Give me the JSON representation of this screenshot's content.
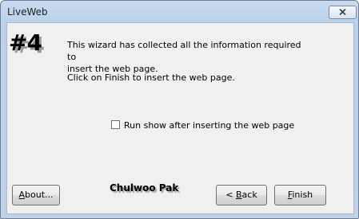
{
  "window": {
    "title": "LiveWeb"
  },
  "wizard": {
    "step": "#4",
    "message_line1": "This wizard has collected all the information required to",
    "message_line2": "insert the web page.",
    "instruction": "Click on Finish to insert the web page.",
    "run_show_checkbox": {
      "label": "Run show after inserting the web page",
      "checked": false
    },
    "author": "Chulwoo Pak"
  },
  "buttons": {
    "about_prefix": "A",
    "about_rest": "bout...",
    "back_prefix": "< ",
    "back_ul": "B",
    "back_rest": "ack",
    "finish_ul": "F",
    "finish_rest": "inish"
  },
  "colors": {
    "client_bg": "#f0f0f0",
    "frame": "#b9d1ea"
  },
  "icons": {
    "close": "close-icon"
  }
}
